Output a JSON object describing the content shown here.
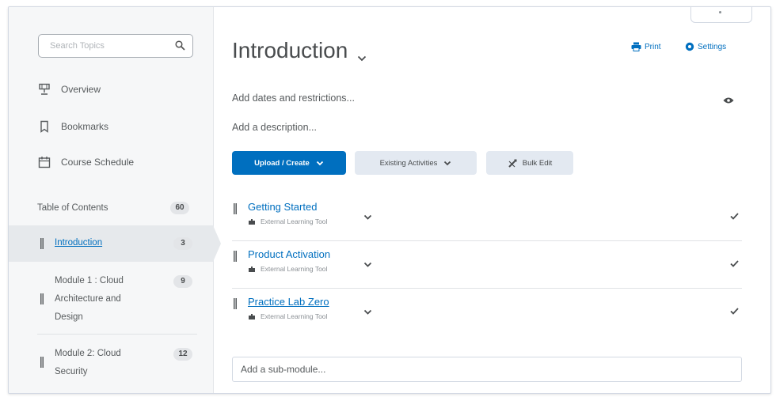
{
  "sidebar": {
    "search_placeholder": "Search Topics",
    "nav": [
      {
        "label": "Overview",
        "icon": "overview-trophy-icon"
      },
      {
        "label": "Bookmarks",
        "icon": "bookmark-icon"
      },
      {
        "label": "Course Schedule",
        "icon": "calendar-icon"
      }
    ],
    "toc": {
      "label": "Table of Contents",
      "count": "60"
    },
    "modules": [
      {
        "label": "Introduction",
        "count": "3",
        "active": true
      },
      {
        "label": "Module 1 : Cloud Architecture and Design",
        "count": "9"
      },
      {
        "label": "Module 2: Cloud Security",
        "count": "12"
      }
    ]
  },
  "main": {
    "title": "Introduction",
    "print_label": "Print",
    "settings_label": "Settings",
    "dates_link": "Add dates and restrictions...",
    "description_link": "Add a description...",
    "buttons": {
      "upload": "Upload / Create",
      "existing": "Existing Activities",
      "bulk": "Bulk Edit"
    },
    "items": [
      {
        "title": "Getting Started",
        "type": "External Learning Tool"
      },
      {
        "title": "Product Activation",
        "type": "External Learning Tool"
      },
      {
        "title": "Practice Lab Zero",
        "type": "External Learning Tool"
      }
    ],
    "submodule_placeholder": "Add a sub-module..."
  },
  "colors": {
    "accent": "#006fbf",
    "sidebar_bg": "#f6f7f8",
    "secondary_btn": "#e3e9f1"
  }
}
